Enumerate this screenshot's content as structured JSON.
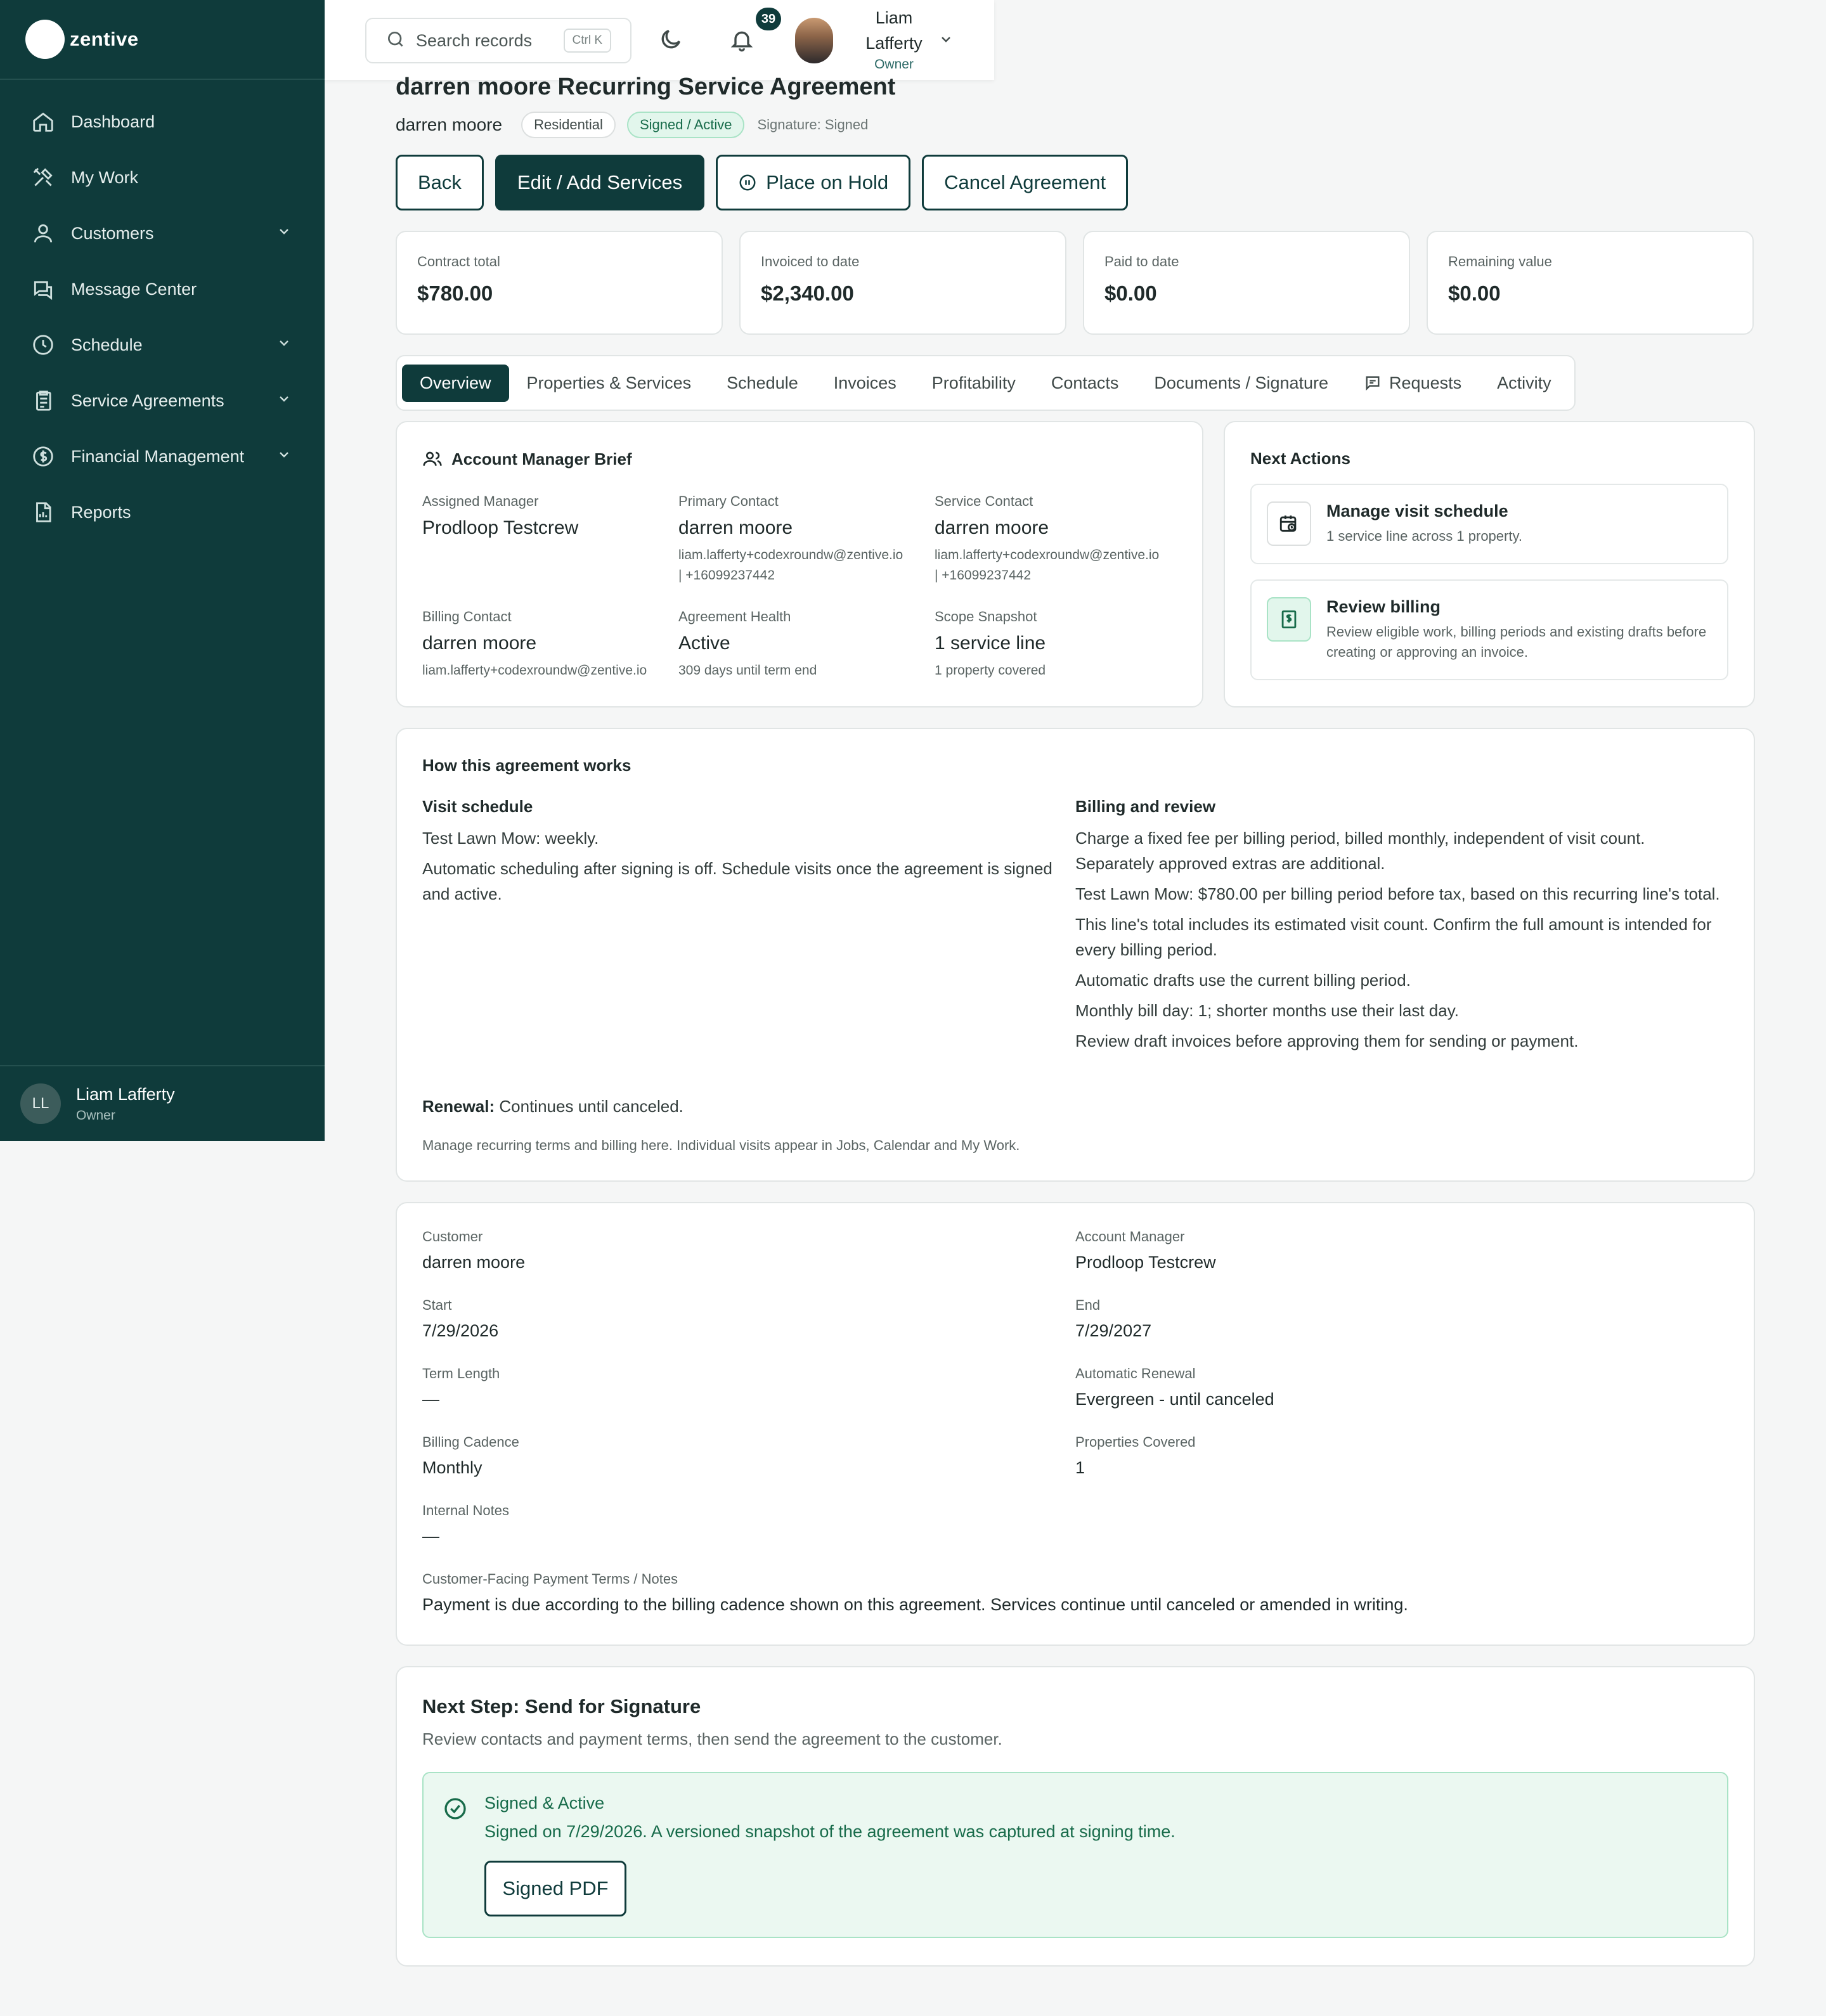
{
  "brand": {
    "name": "zentive"
  },
  "sidebar": {
    "items": [
      {
        "label": "Dashboard",
        "icon": "home-icon",
        "has_chevron": false
      },
      {
        "label": "My Work",
        "icon": "tools-icon",
        "has_chevron": false
      },
      {
        "label": "Customers",
        "icon": "users-icon",
        "has_chevron": true
      },
      {
        "label": "Message Center",
        "icon": "chat-icon",
        "has_chevron": false
      },
      {
        "label": "Schedule",
        "icon": "clock-icon",
        "has_chevron": true
      },
      {
        "label": "Service Agreements",
        "icon": "clipboard-icon",
        "has_chevron": true
      },
      {
        "label": "Financial Management",
        "icon": "dollar-icon",
        "has_chevron": true
      },
      {
        "label": "Reports",
        "icon": "report-icon",
        "has_chevron": false
      }
    ],
    "user": {
      "initials": "LL",
      "name": "Liam Lafferty",
      "role": "Owner"
    }
  },
  "topbar": {
    "search_placeholder": "Search records",
    "shortcut": "Ctrl K",
    "notification_count": "39",
    "user_name": "Liam Lafferty",
    "user_role": "Owner"
  },
  "agreement": {
    "title": "darren moore Recurring Service Agreement",
    "customer": "darren moore",
    "type_badge": "Residential",
    "status_badge": "Signed / Active",
    "signature_status": "Signature: Signed"
  },
  "actions": {
    "back": "Back",
    "edit": "Edit / Add Services",
    "hold": "Place on Hold",
    "cancel": "Cancel Agreement"
  },
  "stats": [
    {
      "label": "Contract total",
      "value": "$780.00"
    },
    {
      "label": "Invoiced to date",
      "value": "$2,340.00"
    },
    {
      "label": "Paid to date",
      "value": "$0.00"
    },
    {
      "label": "Remaining value",
      "value": "$0.00"
    }
  ],
  "tabs": [
    {
      "label": "Overview",
      "active": true
    },
    {
      "label": "Properties & Services"
    },
    {
      "label": "Schedule"
    },
    {
      "label": "Invoices"
    },
    {
      "label": "Profitability"
    },
    {
      "label": "Contacts"
    },
    {
      "label": "Documents / Signature"
    },
    {
      "label": "Requests"
    },
    {
      "label": "Activity"
    }
  ],
  "brief": {
    "title": "Account Manager Brief",
    "fields": [
      {
        "label": "Assigned Manager",
        "value": "Prodloop Testcrew",
        "meta": ""
      },
      {
        "label": "Primary Contact",
        "value": "darren moore",
        "meta": "liam.lafferty+codexroundw@zentive.io",
        "meta2": "| +16099237442"
      },
      {
        "label": "Service Contact",
        "value": "darren moore",
        "meta": "liam.lafferty+codexroundw@zentive.io",
        "meta2": "| +16099237442"
      },
      {
        "label": "Billing Contact",
        "value": "darren moore",
        "meta": "liam.lafferty+codexroundw@zentive.io",
        "meta2": ""
      },
      {
        "label": "Agreement Health",
        "value": "Active",
        "meta": "309 days until term end",
        "meta2": ""
      },
      {
        "label": "Scope Snapshot",
        "value": "1 service line",
        "meta": "1 property covered",
        "meta2": ""
      }
    ]
  },
  "next_actions": {
    "title": "Next Actions",
    "items": [
      {
        "title": "Manage visit schedule",
        "desc": "1 service line across 1 property."
      },
      {
        "title": "Review billing",
        "desc": "Review eligible work, billing periods and existing drafts before creating or approving an invoice."
      }
    ]
  },
  "how": {
    "title": "How this agreement works",
    "visit_title": "Visit schedule",
    "visit_p1": "Test Lawn Mow: weekly.",
    "visit_p2": "Automatic scheduling after signing is off. Schedule visits once the agreement is signed and active.",
    "billing_title": "Billing and review",
    "billing_ps": [
      "Charge a fixed fee per billing period, billed monthly, independent of visit count. Separately approved extras are additional.",
      "Test Lawn Mow: $780.00 per billing period before tax, based on this recurring line's total.",
      "This line's total includes its estimated visit count. Confirm the full amount is intended for every billing period.",
      "Automatic drafts use the current billing period.",
      "Monthly bill day: 1; shorter months use their last day.",
      "Review draft invoices before approving them for sending or payment."
    ],
    "renewal_label": "Renewal:",
    "renewal_value": "Continues until canceled.",
    "note": "Manage recurring terms and billing here. Individual visits appear in Jobs, Calendar and My Work."
  },
  "details": {
    "customer_label": "Customer",
    "customer": "darren moore",
    "manager_label": "Account Manager",
    "manager": "Prodloop Testcrew",
    "start_label": "Start",
    "start": "7/29/2026",
    "end_label": "End",
    "end": "7/29/2027",
    "term_label": "Term Length",
    "term": "—",
    "renewal_label": "Automatic Renewal",
    "renewal": "Evergreen - until canceled",
    "cadence_label": "Billing Cadence",
    "cadence": "Monthly",
    "properties_label": "Properties Covered",
    "properties": "1",
    "notes_label": "Internal Notes",
    "notes": "—",
    "terms_label": "Customer-Facing Payment Terms / Notes",
    "terms": "Payment is due according to the billing cadence shown on this agreement. Services continue until canceled or amended in writing."
  },
  "signature": {
    "title": "Next Step: Send for Signature",
    "desc": "Review contacts and payment terms, then send the agreement to the customer.",
    "status": "Signed & Active",
    "message": "Signed on 7/29/2026. A versioned snapshot of the agreement was captured at signing time.",
    "button": "Signed PDF"
  }
}
